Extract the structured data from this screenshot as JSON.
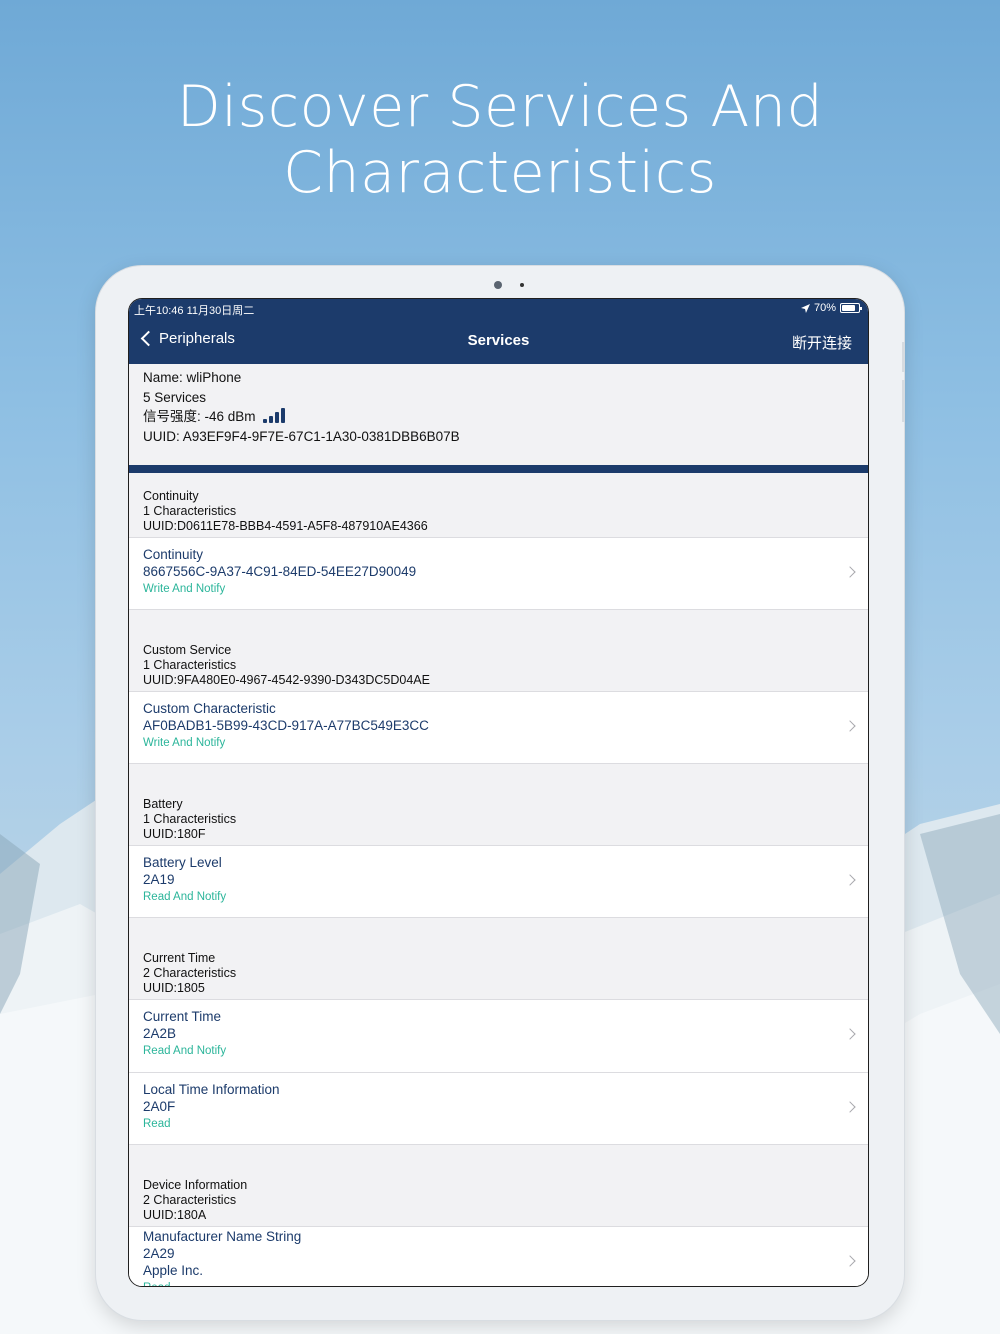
{
  "headline": "Discover Services And Characteristics",
  "status": {
    "time": "上午10:46  11月30日周二",
    "battery": "70%"
  },
  "nav": {
    "back_label": "Peripherals",
    "title": "Services",
    "action_label": "断开连接"
  },
  "peripheral": {
    "name": "Name: wliPhone",
    "services_count": "5 Services",
    "rssi": "信号强度: -46 dBm",
    "uuid": "UUID: A93EF9F4-9F7E-67C1-1A30-0381DBB6B07B"
  },
  "colors": {
    "nav": "#1c3b6b",
    "props": "#2bb59a"
  },
  "services": [
    {
      "name": "Continuity",
      "count": "1 Characteristics",
      "uuid": "UUID:D0611E78-BBB4-4591-A5F8-487910AE4366",
      "characteristics": [
        {
          "name": "Continuity",
          "uuid": "8667556C-9A37-4C91-84ED-54EE27D90049",
          "props": "Write And Notify"
        }
      ]
    },
    {
      "name": "Custom Service",
      "count": "1 Characteristics",
      "uuid": "UUID:9FA480E0-4967-4542-9390-D343DC5D04AE",
      "characteristics": [
        {
          "name": "Custom Characteristic",
          "uuid": "AF0BADB1-5B99-43CD-917A-A77BC549E3CC",
          "props": "Write And Notify"
        }
      ]
    },
    {
      "name": "Battery",
      "count": "1 Characteristics",
      "uuid": "UUID:180F",
      "characteristics": [
        {
          "name": "Battery Level",
          "uuid": "2A19",
          "props": "Read And Notify"
        }
      ]
    },
    {
      "name": "Current Time",
      "count": "2 Characteristics",
      "uuid": "UUID:1805",
      "characteristics": [
        {
          "name": "Current Time",
          "uuid": "2A2B",
          "props": "Read And Notify"
        },
        {
          "name": "Local Time Information",
          "uuid": "2A0F",
          "props": "Read"
        }
      ]
    },
    {
      "name": "Device Information",
      "count": "2 Characteristics",
      "uuid": "UUID:180A",
      "characteristics": [
        {
          "name": "Manufacturer Name String",
          "uuid": "2A29",
          "value": "Apple Inc.",
          "props": "Read"
        }
      ]
    }
  ]
}
